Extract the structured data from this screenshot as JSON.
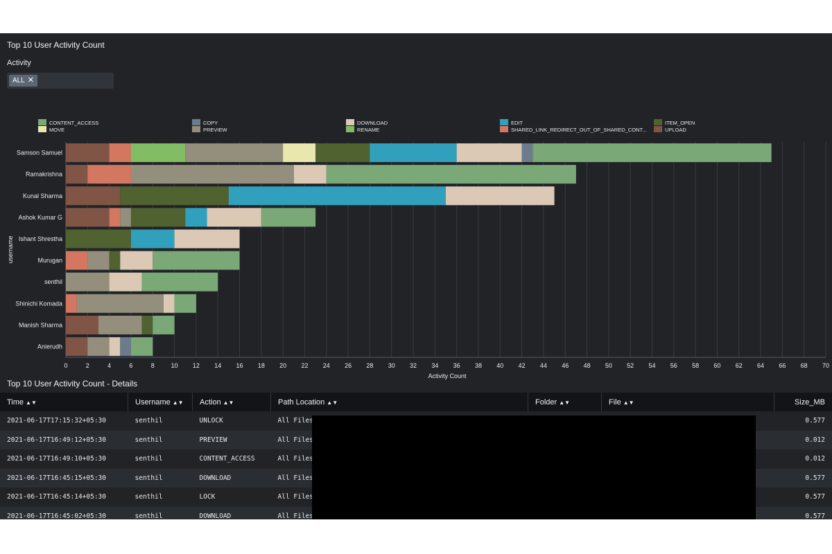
{
  "panel1": {
    "title": "Top 10 User Activity Count"
  },
  "filter": {
    "label": "Activity",
    "chip": "ALL"
  },
  "colors": {
    "CONTENT_ACCESS": "#7aa876",
    "MOVE": "#e9e7ae",
    "COPY": "#6c7c8c",
    "PREVIEW": "#948f7c",
    "DOWNLOAD": "#dbc9b6",
    "RENAME": "#83bd63",
    "EDIT": "#31a0bd",
    "SHARED_LINK_REDIRECT_OUT_OF_SHARED_CONTEXT": "#d47761",
    "ITEM_OPEN": "#4f6230",
    "UPLOAD": "#815546"
  },
  "chart_data": {
    "type": "bar",
    "orientation": "horizontal",
    "stacked": true,
    "xlabel": "Activity Count",
    "ylabel": "username",
    "xlim": [
      0,
      70
    ],
    "x_ticks": [
      "0",
      "2",
      "4",
      "6",
      "8",
      "10",
      "12",
      "14",
      "16",
      "18",
      "20",
      "22",
      "24",
      "26",
      "28",
      "30",
      "32",
      "34",
      "36",
      "38",
      "40",
      "42",
      "44",
      "46",
      "48",
      "50",
      "52",
      "54",
      "56",
      "58",
      "60",
      "62",
      "64",
      "66",
      "68",
      "70"
    ],
    "grid": true,
    "legend": "top",
    "legend_entries": [
      {
        "key": "CONTENT_ACCESS",
        "label": "CONTENT_ACCESS"
      },
      {
        "key": "MOVE",
        "label": "MOVE"
      },
      {
        "key": "COPY",
        "label": "COPY"
      },
      {
        "key": "PREVIEW",
        "label": "PREVIEW"
      },
      {
        "key": "DOWNLOAD",
        "label": "DOWNLOAD"
      },
      {
        "key": "RENAME",
        "label": "RENAME"
      },
      {
        "key": "EDIT",
        "label": "EDIT"
      },
      {
        "key": "SHARED_LINK_REDIRECT_OUT_OF_SHARED_CONTEXT",
        "label": "SHARED_LINK_REDIRECT_OUT_OF_SHARED_CONT..."
      },
      {
        "key": "ITEM_OPEN",
        "label": "ITEM_OPEN"
      },
      {
        "key": "UPLOAD",
        "label": "UPLOAD"
      }
    ],
    "categories": [
      "Samson Samuel",
      "Ramakrishna",
      "Kunal Sharma",
      "Ashok Kumar G",
      "Ishant Shrestha",
      "Murugan",
      "senthil",
      "Shinichi Komada",
      "Manish Sharma",
      "Anierudh"
    ],
    "series": [
      {
        "name": "UPLOAD",
        "values": [
          4,
          2,
          5,
          4,
          0,
          0,
          0,
          0,
          3,
          2
        ]
      },
      {
        "name": "SHARED_LINK_REDIRECT_OUT_OF_SHARED_CONTEXT",
        "values": [
          2,
          4,
          0,
          1,
          0,
          2,
          0,
          1,
          0,
          0
        ]
      },
      {
        "name": "RENAME",
        "values": [
          5,
          0,
          0,
          0,
          0,
          0,
          0,
          0,
          0,
          0
        ]
      },
      {
        "name": "PREVIEW",
        "values": [
          9,
          15,
          0,
          1,
          0,
          2,
          4,
          8,
          4,
          2
        ]
      },
      {
        "name": "MOVE",
        "values": [
          3,
          0,
          0,
          0,
          0,
          0,
          0,
          0,
          0,
          0
        ]
      },
      {
        "name": "ITEM_OPEN",
        "values": [
          5,
          0,
          10,
          5,
          6,
          1,
          0,
          0,
          1,
          0
        ]
      },
      {
        "name": "EDIT",
        "values": [
          8,
          0,
          20,
          2,
          4,
          0,
          0,
          0,
          0,
          0
        ]
      },
      {
        "name": "DOWNLOAD",
        "values": [
          6,
          3,
          10,
          5,
          6,
          3,
          3,
          1,
          0,
          1
        ]
      },
      {
        "name": "COPY",
        "values": [
          1,
          0,
          0,
          0,
          0,
          0,
          0,
          0,
          0,
          1
        ]
      },
      {
        "name": "CONTENT_ACCESS",
        "values": [
          22,
          23,
          0,
          5,
          0,
          8,
          7,
          2,
          2,
          2
        ]
      }
    ]
  },
  "panel2": {
    "title": "Top 10 User Activity Count - Details"
  },
  "table": {
    "columns": [
      "Time",
      "Username",
      "Action",
      "Path Location",
      "Folder",
      "File",
      "Size_MB"
    ],
    "rows": [
      [
        "2021-06-17T17:15:32+05:30",
        "senthil",
        "UNLOCK",
        "All Files",
        "",
        "",
        "0.577"
      ],
      [
        "2021-06-17T16:49:12+05:30",
        "senthil",
        "PREVIEW",
        "All Files",
        "",
        "",
        "0.012"
      ],
      [
        "2021-06-17T16:49:10+05:30",
        "senthil",
        "CONTENT_ACCESS",
        "All Files",
        "",
        "",
        "0.012"
      ],
      [
        "2021-06-17T16:45:15+05:30",
        "senthil",
        "DOWNLOAD",
        "All Files",
        "",
        "",
        "0.577"
      ],
      [
        "2021-06-17T16:45:14+05:30",
        "senthil",
        "LOCK",
        "All Files",
        "",
        "",
        "0.577"
      ],
      [
        "2021-06-17T16:45:02+05:30",
        "senthil",
        "DOWNLOAD",
        "All Files",
        "",
        "",
        "0.577"
      ]
    ]
  }
}
